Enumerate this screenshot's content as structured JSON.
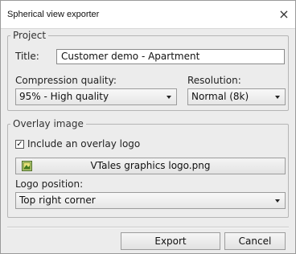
{
  "dialog": {
    "title": "Spherical view exporter",
    "close_symbol": "×"
  },
  "project": {
    "legend": "Project",
    "title_label": "Title:",
    "title_value": "Customer demo - Apartment",
    "compression_label": "Compression quality:",
    "compression_value": "95% - High quality",
    "resolution_label": "Resolution:",
    "resolution_value": "Normal (8k)"
  },
  "overlay": {
    "legend": "Overlay image",
    "checkbox_label": "Include an overlay logo",
    "checkbox_checked": true,
    "checkbox_mark": "✓",
    "file_name": "VTales graphics logo.png",
    "position_label": "Logo position:",
    "position_value": "Top right corner"
  },
  "buttons": {
    "export_label": "Export",
    "cancel_label": "Cancel"
  },
  "colors": {
    "dialog_bg": "#ececec",
    "titlebar_bg": "#ffffff",
    "border": "#b5b5b5"
  }
}
